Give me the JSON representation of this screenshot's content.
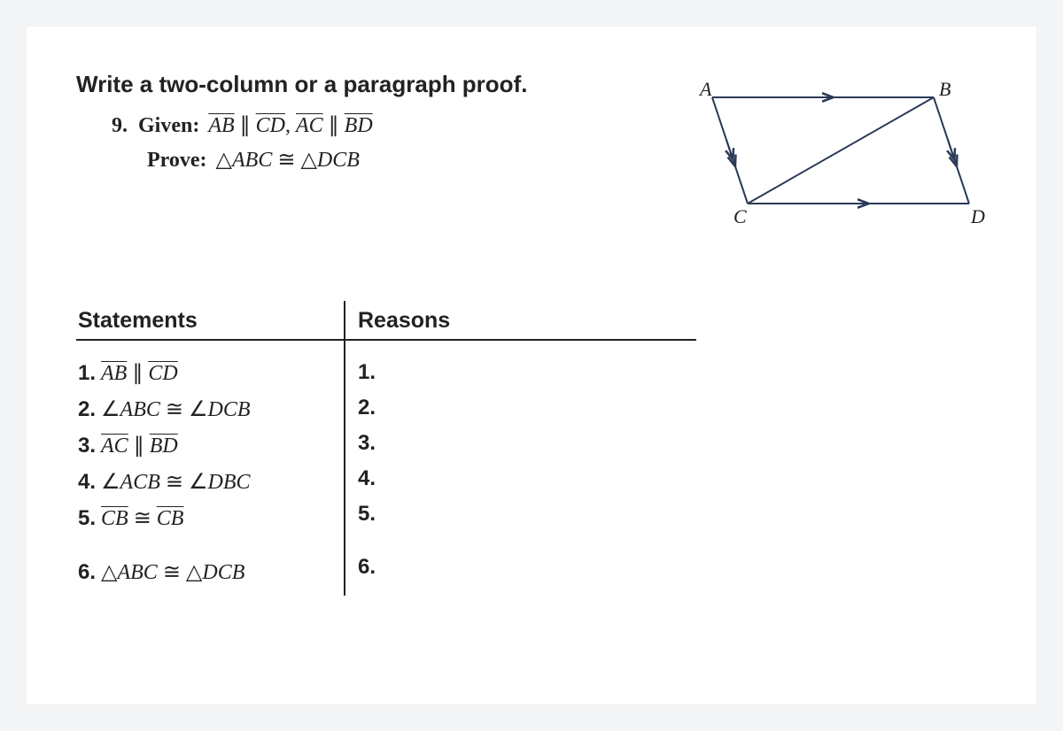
{
  "prompt": "Write a two-column or a paragraph proof.",
  "problem_number": "9.",
  "given_label": "Given:",
  "given_math_html": "<span class='seg'>AB</span> &#8741; <span class='seg'>CD</span>, <span class='seg'>AC</span> &#8741; <span class='seg'>BD</span>",
  "prove_label": "Prove:",
  "prove_math_html": "<span class='tri'>&#9651;</span><span class='math-i'>ABC</span> <span class='cong'>&#8773;</span> <span class='tri'>&#9651;</span><span class='math-i'>DCB</span>",
  "figure": {
    "labels": {
      "A": "A",
      "B": "B",
      "C": "C",
      "D": "D"
    }
  },
  "columns": {
    "statements": "Statements",
    "reasons": "Reasons"
  },
  "rows": [
    {
      "n": "1.",
      "stmt_html": "<span class='seg'>AB</span> &#8741; <span class='seg'>CD</span>",
      "reason_n": "1."
    },
    {
      "n": "2.",
      "stmt_html": "<span class='ang'>&#8736;</span><span class='math-i'>ABC</span> <span class='cong'>&#8773;</span> <span class='ang'>&#8736;</span><span class='math-i'>DCB</span>",
      "reason_n": "2."
    },
    {
      "n": "3.",
      "stmt_html": "<span class='seg'>AC</span> &#8741; <span class='seg'>BD</span>",
      "reason_n": "3."
    },
    {
      "n": "4.",
      "stmt_html": "<span class='ang'>&#8736;</span><span class='math-i'>ACB</span> <span class='cong'>&#8773;</span> <span class='ang'>&#8736;</span><span class='math-i'>DBC</span>",
      "reason_n": "4."
    },
    {
      "n": "5.",
      "stmt_html": "<span class='seg'>CB</span> <span class='cong'>&#8773;</span> <span class='seg'>CB</span>",
      "reason_n": "5."
    }
  ],
  "final_row": {
    "n": "6.",
    "stmt_html": "<span class='tri'>&#9651;</span><span class='math-i'>ABC</span> <span class='cong'>&#8773;</span> <span class='tri'>&#9651;</span><span class='math-i'>DCB</span>",
    "reason_n": "6."
  }
}
